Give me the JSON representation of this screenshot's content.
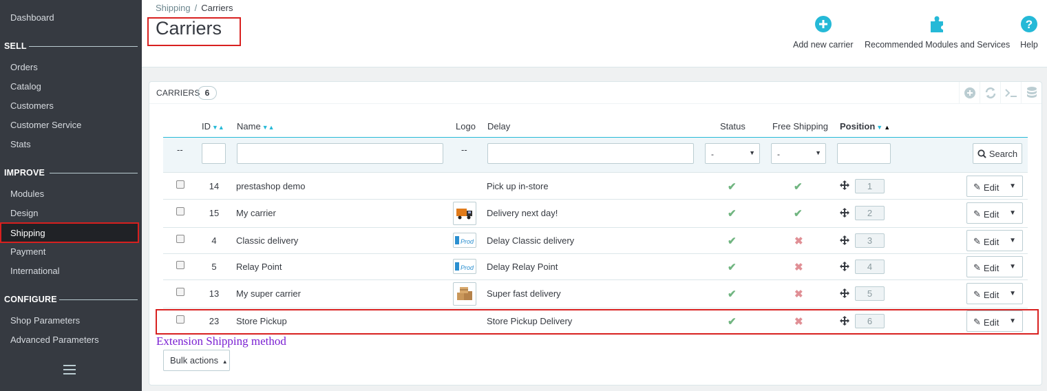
{
  "sidebar": {
    "dashboard": "Dashboard",
    "sections": [
      {
        "title": "SELL",
        "items": [
          "Orders",
          "Catalog",
          "Customers",
          "Customer Service",
          "Stats"
        ]
      },
      {
        "title": "IMPROVE",
        "items": [
          "Modules",
          "Design",
          "Shipping",
          "Payment",
          "International"
        ]
      },
      {
        "title": "CONFIGURE",
        "items": [
          "Shop Parameters",
          "Advanced Parameters"
        ]
      }
    ],
    "active_item": "Shipping"
  },
  "header": {
    "breadcrumb": [
      "Shipping",
      "/",
      "Carriers"
    ],
    "title": "Carriers",
    "toolbar": {
      "add_new": "Add new carrier",
      "recommended": "Recommended Modules and Services",
      "help": "Help"
    }
  },
  "panel": {
    "title": "CARRIERS",
    "count": "6",
    "columns": {
      "id": "ID",
      "name": "Name",
      "logo": "Logo",
      "delay": "Delay",
      "status": "Status",
      "free_shipping": "Free Shipping",
      "position": "Position"
    },
    "filters": {
      "dash": "--",
      "status_select": "-",
      "free_select": "-",
      "search_label": "Search"
    },
    "rows": [
      {
        "id": "14",
        "name": "prestashop demo",
        "logo": "",
        "delay": "Pick up in-store",
        "status": "enabled",
        "free_shipping": "yes",
        "position": "1"
      },
      {
        "id": "15",
        "name": "My carrier",
        "logo": "truck-logo",
        "delay": "Delivery next day!",
        "status": "enabled",
        "free_shipping": "yes",
        "position": "2"
      },
      {
        "id": "4",
        "name": "Classic delivery",
        "logo": "prod-logo",
        "delay": "Delay Classic delivery",
        "status": "enabled",
        "free_shipping": "no",
        "position": "3"
      },
      {
        "id": "5",
        "name": "Relay Point",
        "logo": "prod-logo",
        "delay": "Delay Relay Point",
        "status": "enabled",
        "free_shipping": "no",
        "position": "4"
      },
      {
        "id": "13",
        "name": "My super carrier",
        "logo": "boxes-logo",
        "delay": "Super fast delivery",
        "status": "enabled",
        "free_shipping": "no",
        "position": "5"
      },
      {
        "id": "23",
        "name": "Store Pickup",
        "logo": "",
        "delay": "Store Pickup Delivery",
        "status": "enabled",
        "free_shipping": "no",
        "position": "6"
      }
    ],
    "edit_label": "Edit",
    "bulk_actions": "Bulk actions"
  },
  "annotation": "Extension Shipping method",
  "colors": {
    "accent": "#25b9d7",
    "highlight": "#d8201f",
    "annotation": "#7a1fd2",
    "ok": "#70b580",
    "no": "#e08f95"
  }
}
